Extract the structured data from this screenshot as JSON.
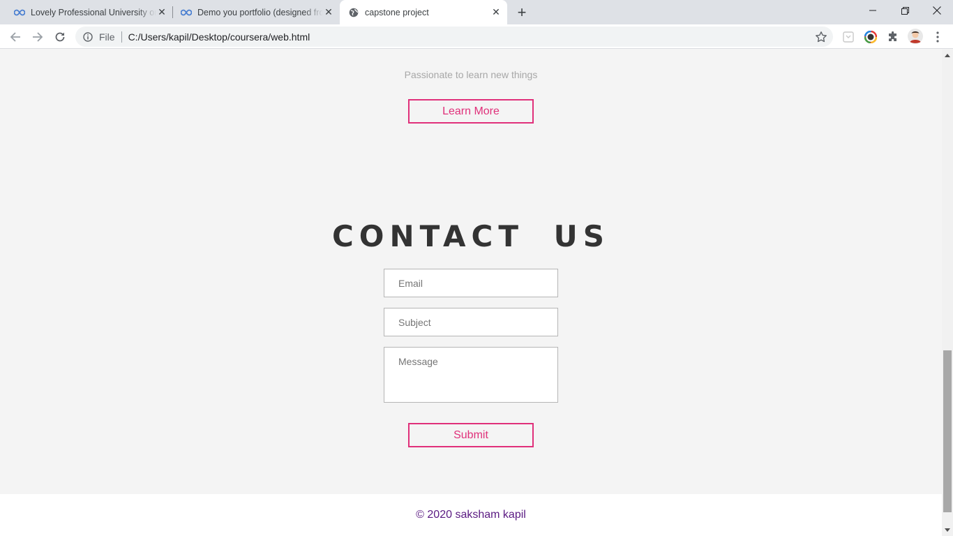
{
  "browser": {
    "tabs": [
      {
        "title": "Lovely Professional University on",
        "icon": "infinity-icon",
        "active": false
      },
      {
        "title": "Demo you portfolio (designed fro",
        "icon": "infinity-icon",
        "active": false
      },
      {
        "title": "capstone project",
        "icon": "globe-icon",
        "active": true
      }
    ],
    "new_tab_icon": "plus-icon",
    "address": {
      "scheme_label": "File",
      "url": "C:/Users/kapil/Desktop/coursera/web.html"
    }
  },
  "page": {
    "tagline": "Passionate to learn new things",
    "learn_more_label": "Learn More",
    "contact": {
      "title": "CONTACT US",
      "email_placeholder": "Email",
      "subject_placeholder": "Subject",
      "message_placeholder": "Message",
      "submit_label": "Submit"
    },
    "footer_text": "© 2020 saksham kapil"
  },
  "colors": {
    "accent": "#e0307a",
    "footer_text": "#5a1a82",
    "page_bg": "#f4f4f4",
    "heading": "#333333"
  },
  "scroll": {
    "position_fraction": 0.96
  }
}
